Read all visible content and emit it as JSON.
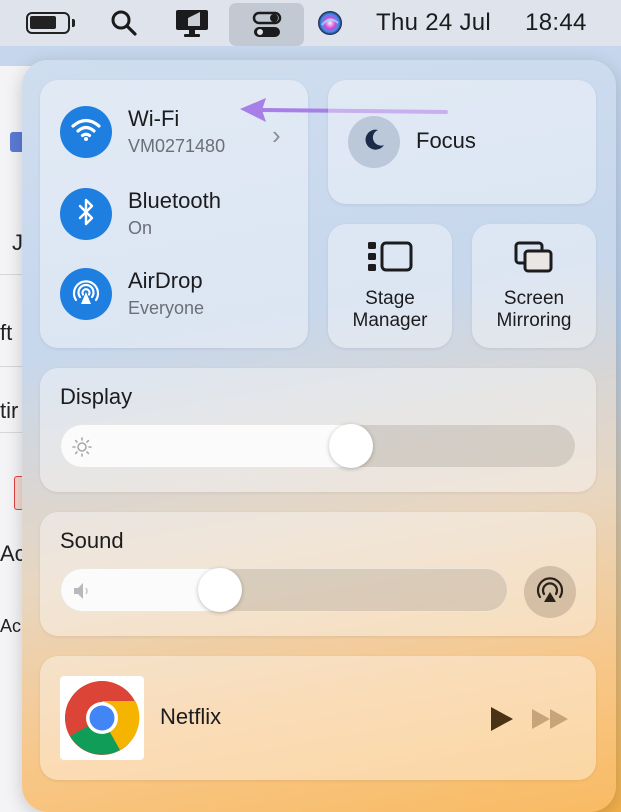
{
  "menubar": {
    "date": "Thu 24 Jul",
    "time": "18:44"
  },
  "background_window": {
    "fragments": [
      "J",
      "ft",
      "tir",
      "Ac",
      "Ac"
    ]
  },
  "network": {
    "wifi": {
      "title": "Wi-Fi",
      "subtitle": "VM0271480",
      "icon": "wifi-icon"
    },
    "bluetooth": {
      "title": "Bluetooth",
      "subtitle": "On",
      "icon": "bluetooth-icon"
    },
    "airdrop": {
      "title": "AirDrop",
      "subtitle": "Everyone",
      "icon": "airdrop-icon"
    }
  },
  "focus": {
    "label": "Focus",
    "icon": "moon-icon"
  },
  "stage_manager": {
    "line1": "Stage",
    "line2": "Manager"
  },
  "screen_mirroring": {
    "line1": "Screen",
    "line2": "Mirroring"
  },
  "display": {
    "label": "Display",
    "level": 0.57
  },
  "sound": {
    "label": "Sound",
    "level": 0.34
  },
  "now_playing": {
    "title": "Netflix",
    "app_icon": "chrome-icon"
  },
  "colors": {
    "accent_blue": "#1f7fe0",
    "arrow_purple": "#a77fe6"
  }
}
